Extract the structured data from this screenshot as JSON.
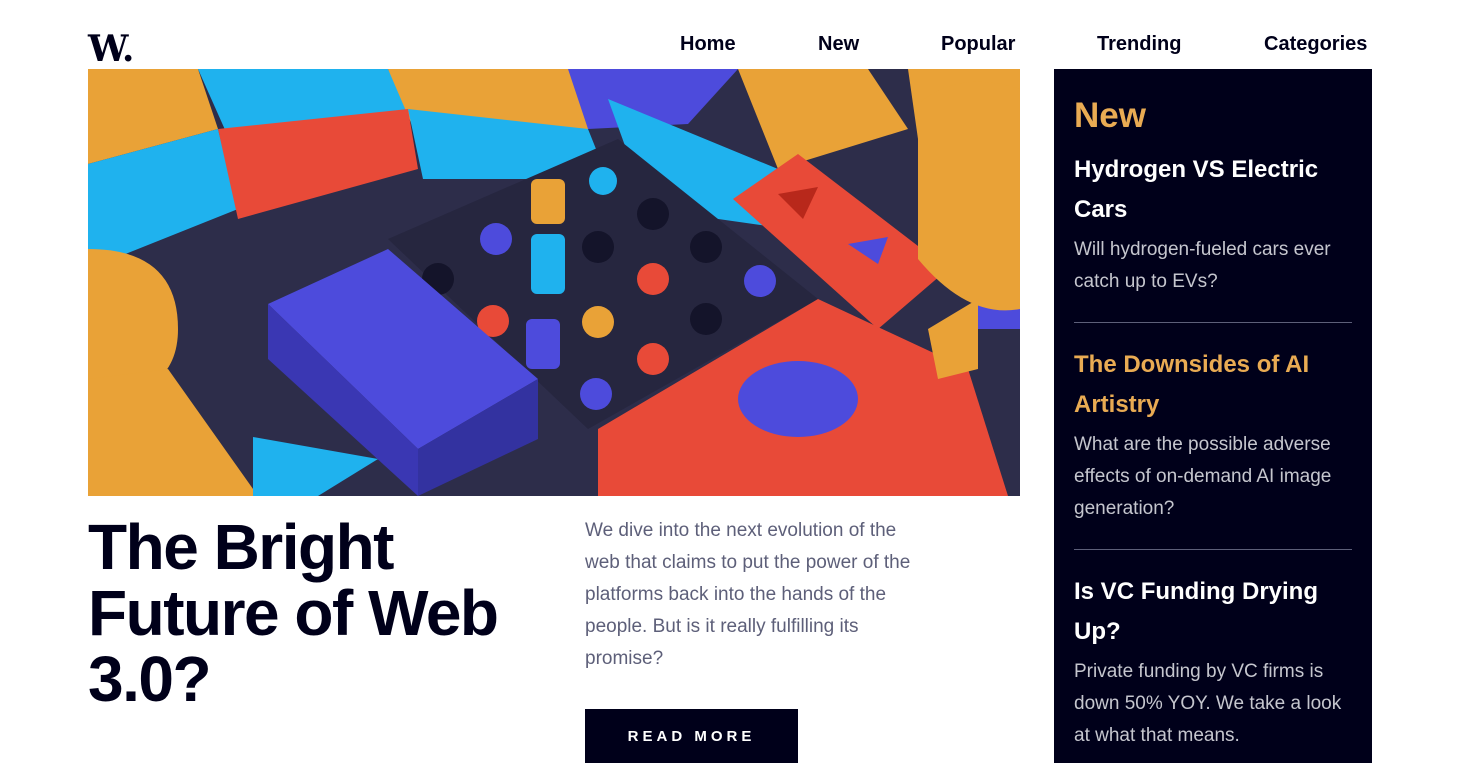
{
  "brand": {
    "logo": "W."
  },
  "nav": {
    "items": [
      "Home",
      "New",
      "Popular",
      "Trending",
      "Categories"
    ]
  },
  "hero": {
    "title": "The Bright Future of Web 3.0?",
    "description": "We dive into the next evolution of the web that claims to put the power of the platforms back into the hands of the people. But is it really fulfilling its promise?",
    "cta": "READ MORE"
  },
  "sidebar": {
    "heading": "New",
    "items": [
      {
        "title": "Hydrogen VS Electric Cars",
        "text": "Will hydrogen-fueled cars ever catch up to EVs?"
      },
      {
        "title": "The Downsides of AI Artistry",
        "text": "What are the possible adverse effects of on-demand AI image generation?"
      },
      {
        "title": "Is VC Funding Drying Up?",
        "text": "Private funding by VC firms is down 50% YOY. We take a look at what that means."
      }
    ]
  },
  "colors": {
    "ink": "#00001a",
    "accent": "#e9ab53",
    "muted": "#5d5f79",
    "blue": "#4d4bdc",
    "red": "#e84a38",
    "cyan": "#1fb2ee",
    "orange": "#e9a237"
  }
}
